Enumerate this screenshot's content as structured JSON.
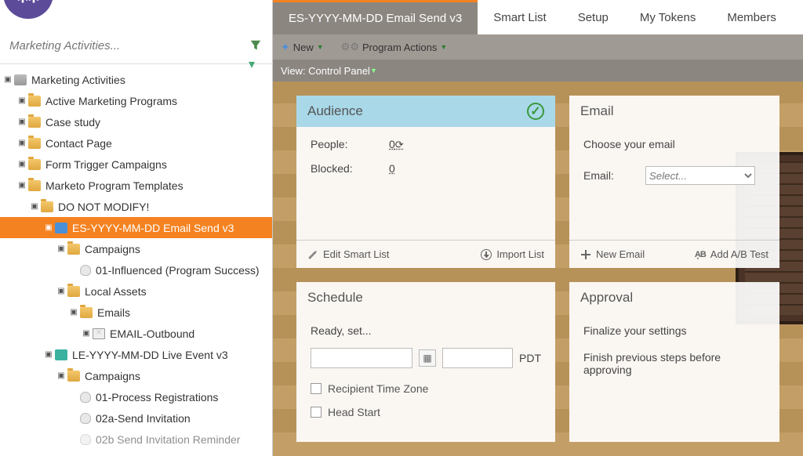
{
  "search": {
    "placeholder": "Marketing Activities..."
  },
  "tree": {
    "root": "Marketing Activities",
    "n1": "Active Marketing Programs",
    "n2": "Case study",
    "n3": "Contact Page",
    "n4": "Form Trigger Campaigns",
    "n5": "Marketo Program Templates",
    "n6": "DO NOT MODIFY!",
    "n7": "ES-YYYY-MM-DD Email Send v3",
    "n8": "Campaigns",
    "n9": "01-Influenced (Program Success)",
    "n10": "Local Assets",
    "n11": "Emails",
    "n12": "EMAIL-Outbound",
    "n13": "LE-YYYY-MM-DD Live Event v3",
    "n14": "Campaigns",
    "n15": "01-Process Registrations",
    "n16": "02a-Send Invitation",
    "n17": "02b Send Invitation Reminder"
  },
  "tabs": {
    "t0": "ES-YYYY-MM-DD Email Send v3",
    "t1": "Smart List",
    "t2": "Setup",
    "t3": "My Tokens",
    "t4": "Members"
  },
  "toolbar": {
    "new": "New",
    "actions": "Program Actions"
  },
  "view": {
    "label": "View: Control Panel"
  },
  "audience": {
    "title": "Audience",
    "people_k": "People:",
    "people_v": "0",
    "blocked_k": "Blocked:",
    "blocked_v": "0",
    "edit": "Edit Smart List",
    "import": "Import List"
  },
  "email": {
    "title": "Email",
    "sub": "Choose your email",
    "label": "Email:",
    "placeholder": "Select...",
    "new": "New Email",
    "ab": "Add A/B Test"
  },
  "schedule": {
    "title": "Schedule",
    "sub": "Ready, set...",
    "tz": "PDT",
    "rtz": "Recipient Time Zone",
    "hs": "Head Start"
  },
  "approval": {
    "title": "Approval",
    "sub": "Finalize your settings",
    "msg": "Finish previous steps before approving"
  }
}
